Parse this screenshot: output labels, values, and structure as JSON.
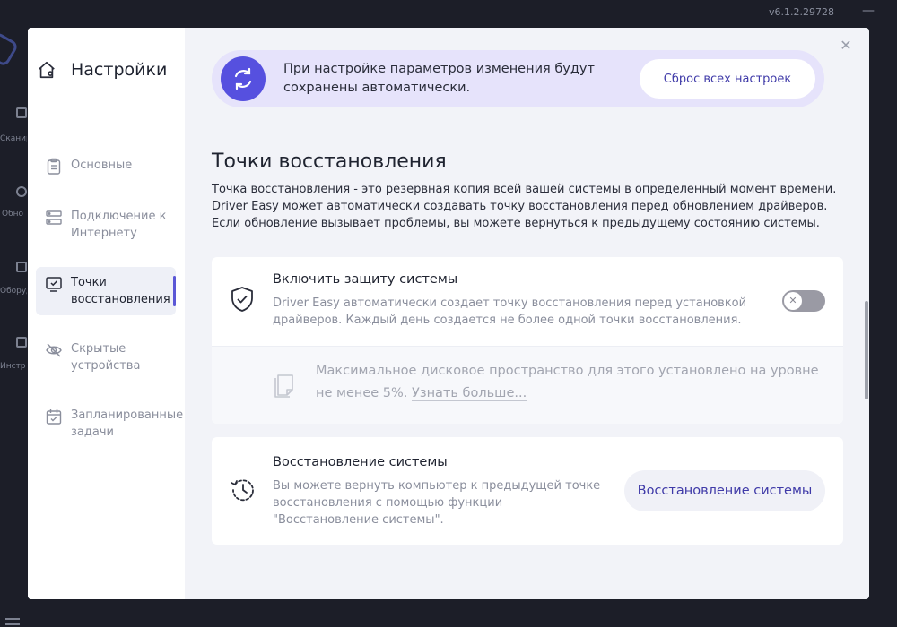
{
  "background_app": {
    "version": "v6.1.2.29728",
    "sidebar_items": [
      "Сканир",
      "Обно",
      "Оборуд",
      "Инстр"
    ]
  },
  "sidebar": {
    "title": "Настройки",
    "items": [
      {
        "label": "Основные",
        "icon": "clipboard-icon",
        "active": false
      },
      {
        "label": "Подключение к Интернету",
        "icon": "network-icon",
        "active": false
      },
      {
        "label": "Точки восстановления",
        "icon": "restore-point-icon",
        "active": true
      },
      {
        "label": "Скрытые устройства",
        "icon": "eye-off-icon",
        "active": false
      },
      {
        "label": "Запланированные задачи",
        "icon": "calendar-check-icon",
        "active": false
      }
    ]
  },
  "banner": {
    "text": "При настройке параметров изменения будут сохранены автоматически.",
    "button": "Сброс всех настроек"
  },
  "section": {
    "title": "Точки восстановления",
    "description": "Точка восстановления - это резервная копия всей вашей системы в определенный момент времени. Driver Easy может автоматически создавать точку восстановления перед обновлением драйверов. Если обновление вызывает проблемы, вы можете вернуться к предыдущему состоянию системы."
  },
  "protection": {
    "title": "Включить защиту системы",
    "description": "Driver Easy автоматически создает точку восстановления перед установкой драйверов. Каждый день создается не более одной точки восстановления.",
    "enabled": false
  },
  "disk": {
    "text": "Максимальное дисковое пространство для этого установлено на уровне не менее 5%.",
    "link": "Узнать больше..."
  },
  "system_restore": {
    "title": "Восстановление системы",
    "description": "Вы можете вернуть компьютер к предыдущей точке восстановления с помощью функции \"Восстановление системы\".",
    "button": "Восстановление системы"
  },
  "colors": {
    "accent": "#5650df",
    "accent_text": "#3f3aa8",
    "banner_bg": "#e6e3fb"
  }
}
